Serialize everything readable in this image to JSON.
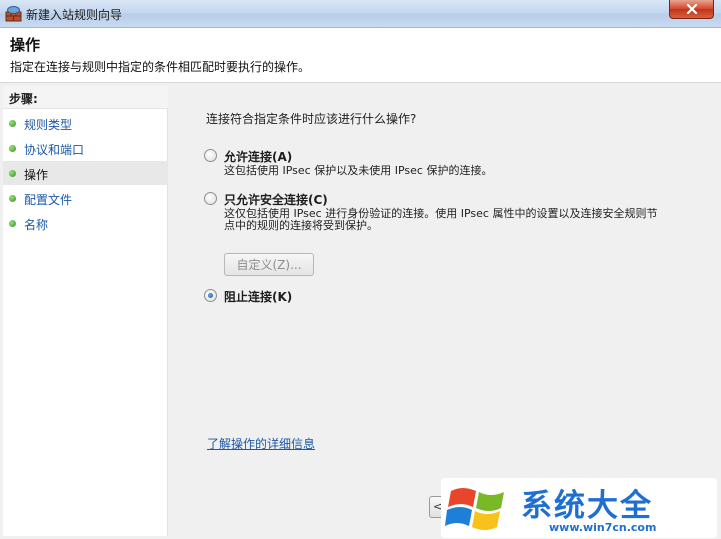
{
  "window": {
    "title": "新建入站规则向导"
  },
  "header": {
    "title": "操作",
    "description": "指定在连接与规则中指定的条件相匹配时要执行的操作。"
  },
  "steps": {
    "heading": "步骤:",
    "items": [
      {
        "label": "规则类型",
        "state": "link"
      },
      {
        "label": "协议和端口",
        "state": "link"
      },
      {
        "label": "操作",
        "state": "current"
      },
      {
        "label": "配置文件",
        "state": "link"
      },
      {
        "label": "名称",
        "state": "link"
      }
    ]
  },
  "main": {
    "question": "连接符合指定条件时应该进行什么操作?",
    "options": [
      {
        "label": "允许连接(A)",
        "description": "这包括使用 IPsec 保护以及未使用 IPsec 保护的连接。",
        "checked": false
      },
      {
        "label": "只允许安全连接(C)",
        "description": "这仅包括使用 IPsec 进行身份验证的连接。使用 IPsec 属性中的设置以及连接安全规则节点中的规则的连接将受到保护。",
        "checked": false
      },
      {
        "label": "阻止连接(K)",
        "description": "",
        "checked": true
      }
    ],
    "customize_button": "自定义(Z)...",
    "learn_more_link": "了解操作的详细信息",
    "partial_button_text": "<"
  },
  "watermark": {
    "title": "系统大全",
    "url": "www.win7cn.com"
  },
  "colors": {
    "link": "#1a58a8",
    "watermark": "#1f6fd1",
    "close_button": "#c0341b"
  },
  "icons": {
    "app": "firewall-wall-icon",
    "close": "close-icon",
    "step_bullet": "green-dot-icon",
    "watermark_logo": "windows-flag-icon"
  }
}
